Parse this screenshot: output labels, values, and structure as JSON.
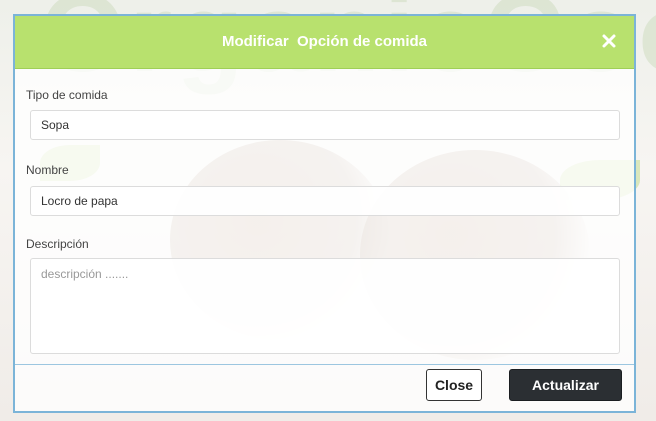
{
  "modal": {
    "title": "Modificar  Opción de comida",
    "fields": {
      "tipo": {
        "label": "Tipo de comida",
        "value": "Sopa"
      },
      "nombre": {
        "label": "Nombre",
        "value": "Locro de papa"
      },
      "descripcion": {
        "label": "Descripción",
        "placeholder": "descripción ......."
      }
    },
    "buttons": {
      "close_label": "Close",
      "update_label": "Actualizar"
    }
  },
  "colors": {
    "header_bg": "#b8e16e",
    "border": "#7bb4d8",
    "update_button_bg": "#2b2f33"
  },
  "icons": {
    "close": "close-icon"
  }
}
